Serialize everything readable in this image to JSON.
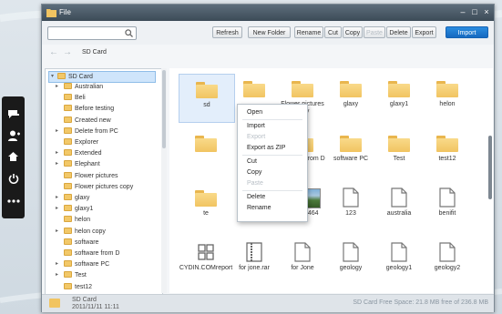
{
  "window": {
    "title": "File"
  },
  "toolbar": {
    "search_placeholder": "",
    "refresh": "Refresh",
    "new_folder": "New Folder",
    "rename": "Rename",
    "cut": "Cut",
    "copy": "Copy",
    "paste": "Paste",
    "delete": "Delete",
    "export": "Export",
    "import": "Import"
  },
  "nav": {
    "back": "←",
    "forward": "→",
    "path": "SD Card"
  },
  "tree": {
    "root": "SD Card",
    "items": [
      {
        "label": "Australian",
        "expandable": true
      },
      {
        "label": "Beli",
        "expandable": false
      },
      {
        "label": "Before testing",
        "expandable": false
      },
      {
        "label": "Created new",
        "expandable": false
      },
      {
        "label": "Delete from PC",
        "expandable": true
      },
      {
        "label": "Explorer",
        "expandable": false
      },
      {
        "label": "Extended",
        "expandable": true
      },
      {
        "label": "Elephant",
        "expandable": true
      },
      {
        "label": "Flower pictures",
        "expandable": false
      },
      {
        "label": "Flower pictures copy",
        "expandable": false
      },
      {
        "label": "glaxy",
        "expandable": true
      },
      {
        "label": "glaxy1",
        "expandable": true
      },
      {
        "label": "helon",
        "expandable": false
      },
      {
        "label": "helon copy",
        "expandable": true
      },
      {
        "label": "software",
        "expandable": false
      },
      {
        "label": "software from D",
        "expandable": false
      },
      {
        "label": "software PC",
        "expandable": true
      },
      {
        "label": "Test",
        "expandable": true
      },
      {
        "label": "test12",
        "expandable": false
      }
    ]
  },
  "grid": {
    "rows": [
      [
        {
          "label": "sd",
          "type": "folder"
        },
        {
          "label": "",
          "type": "folder"
        },
        {
          "label": "Flower pictures copy",
          "type": "folder"
        },
        {
          "label": "glaxy",
          "type": "folder"
        },
        {
          "label": "glaxy1",
          "type": "folder"
        },
        {
          "label": "helon",
          "type": "folder"
        }
      ],
      [
        {
          "label": "",
          "type": "folder"
        },
        {
          "label": "",
          "type": "folder"
        },
        {
          "label": "software from D",
          "type": "folder"
        },
        {
          "label": "software PC",
          "type": "folder"
        },
        {
          "label": "Test",
          "type": "folder"
        },
        {
          "label": "test12",
          "type": "folder"
        }
      ],
      [
        {
          "label": "te",
          "type": "folder"
        },
        {
          "label": "",
          "type": "blank"
        },
        {
          "label": "125746464",
          "type": "photo"
        },
        {
          "label": "123",
          "type": "doc"
        },
        {
          "label": "australia",
          "type": "doc"
        },
        {
          "label": "benifit",
          "type": "doc"
        }
      ],
      [
        {
          "label": "CYDIN.COMreport",
          "type": "app"
        },
        {
          "label": "for jone.rar",
          "type": "archive"
        },
        {
          "label": "for Jone",
          "type": "doc"
        },
        {
          "label": "geology",
          "type": "doc"
        },
        {
          "label": "geology1",
          "type": "doc"
        },
        {
          "label": "geology2",
          "type": "doc"
        }
      ]
    ]
  },
  "context_menu": {
    "open": "Open",
    "import": "Import",
    "export": "Export",
    "export_zip": "Export as ZIP",
    "cut": "Cut",
    "copy": "Copy",
    "paste": "Paste",
    "delete": "Delete",
    "rename": "Rename"
  },
  "status": {
    "sd_name": "SD Card",
    "sd_date": "2011/11/11  11:11",
    "free_space": "SD Card Free Space: 21.8 MB free of 236.8 MB"
  },
  "colors": {
    "accent": "#1f7bd6",
    "titlebar": "#4a5a67",
    "folder": "#f1c461"
  }
}
